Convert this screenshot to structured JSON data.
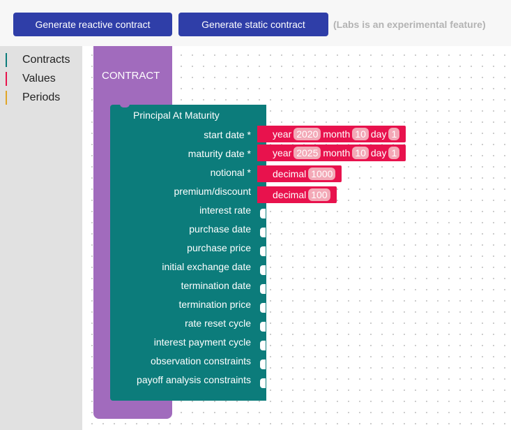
{
  "toolbar": {
    "reactive_label": "Generate reactive contract",
    "static_label": "Generate static contract",
    "labs_note": "(Labs is an experimental feature)"
  },
  "sidebar": {
    "categories": [
      {
        "label": "Contracts",
        "color": "#0c7c7b"
      },
      {
        "label": "Values",
        "color": "#e8124d"
      },
      {
        "label": "Periods",
        "color": "#e0a526"
      }
    ]
  },
  "contract_block": {
    "label": "CONTRACT",
    "color": "#a16bbd"
  },
  "pam_block": {
    "title": "Principal At Maturity",
    "color": "#0c7c7b",
    "fields": [
      "start date *",
      "maturity date *",
      "notional *",
      "premium/discount",
      "interest rate",
      "purchase date",
      "purchase price",
      "initial exchange date",
      "termination date",
      "termination price",
      "rate reset cycle",
      "interest payment cycle",
      "observation constraints",
      "payoff analysis constraints"
    ]
  },
  "values": {
    "start_date": {
      "year_label": "year",
      "year": "2020",
      "month_label": "month",
      "month": "10",
      "day_label": "day",
      "day": "1"
    },
    "maturity_date": {
      "year_label": "year",
      "year": "2025",
      "month_label": "month",
      "month": "10",
      "day_label": "day",
      "day": "1"
    },
    "notional": {
      "label": "decimal",
      "value": "1000"
    },
    "premium_discount": {
      "label": "decimal",
      "value": "100"
    },
    "color": "#e8124d"
  }
}
